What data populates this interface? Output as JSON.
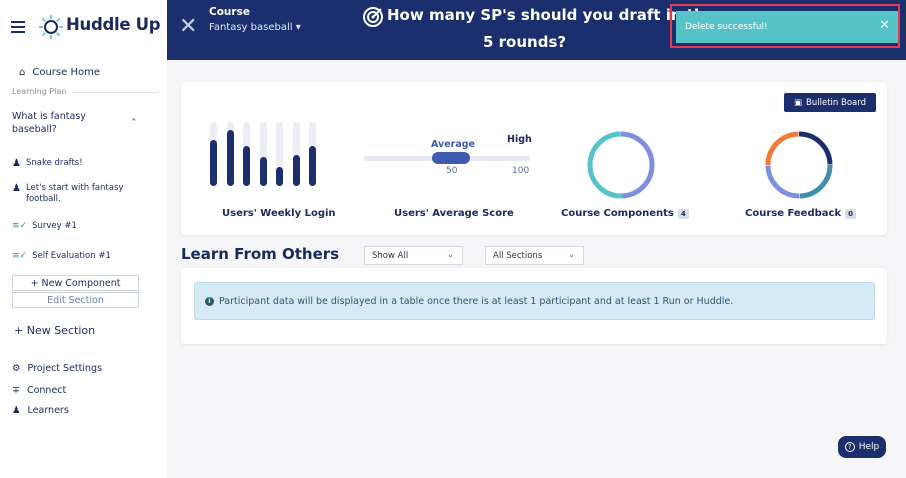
{
  "brand": {
    "name": "Huddle Up"
  },
  "sidebar": {
    "course_home": "Course Home",
    "learning_plan_label": "Learning Plan",
    "plan_item": "What is fantasy baseball?",
    "components": [
      "Snake drafts!",
      "Let's start with fantasy football."
    ],
    "survey": "Survey #1",
    "self_eval": "Self Evaluation #1",
    "new_component": "+ New Component",
    "edit_section": "Edit Section",
    "new_section": "+ New Section",
    "project_settings": "Project Settings",
    "connect": "Connect",
    "learners": "Learners"
  },
  "topbar": {
    "course_label": "Course",
    "course_name": "Fantasy baseball",
    "title_line1": "How many SP's should you draft in the",
    "title_line2": "5 rounds?"
  },
  "toast": {
    "message": "Delete successful!"
  },
  "stats": {
    "bulletin_board": "Bulletin Board",
    "weekly_login_label": "Users' Weekly Login",
    "weekly_login_values": [
      0.72,
      0.88,
      0.62,
      0.45,
      0.3,
      0.48,
      0.62
    ],
    "avg_score_label": "Users' Average Score",
    "avg_word": "Average",
    "high_word": "High",
    "avg_value": "50",
    "high_value": "100",
    "components_label": "Course Components",
    "components_count": "4",
    "feedback_label": "Course Feedback",
    "feedback_count": "0"
  },
  "learn": {
    "title": "Learn From Others",
    "filter1": "Show All",
    "filter2": "All Sections",
    "info": "Participant data will be displayed in a table once there is at least 1 participant and at least 1 Run or Huddle."
  },
  "help": "Help",
  "colors": {
    "navy": "#1b2f6f",
    "teal": "#56c3c9",
    "lavender": "#7e8fe0",
    "orange": "#f07a3a"
  }
}
